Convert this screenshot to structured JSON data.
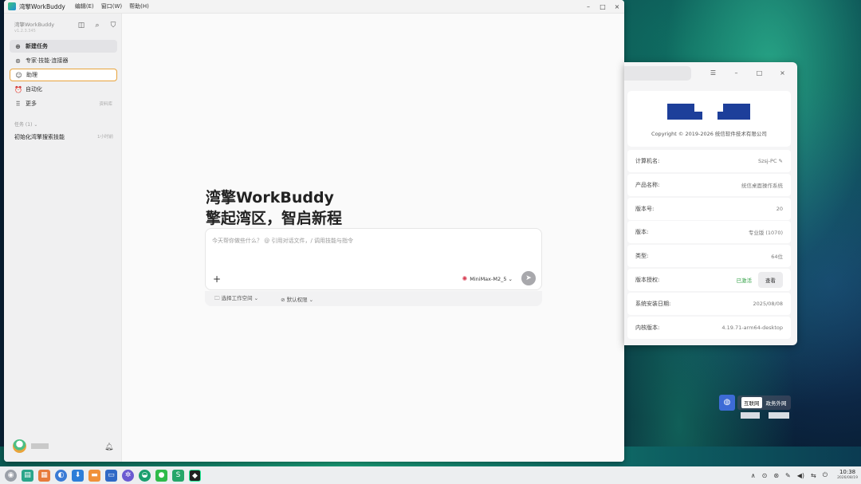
{
  "app": {
    "name": "湾擎WorkBuddy",
    "menus": [
      "编辑(E)",
      "窗口(W)",
      "帮助(H)"
    ],
    "controls": {
      "minimize": "–",
      "maximize": "□",
      "close": "×"
    }
  },
  "sidebar": {
    "brand_title": "湾擎WorkBuddy",
    "brand_version": "v1.2.3.345",
    "tools": [
      {
        "icon": "panel-toggle-icon",
        "glyph": "◫"
      },
      {
        "icon": "search-icon",
        "glyph": "⌕"
      },
      {
        "icon": "filter-icon",
        "glyph": "⛉"
      }
    ],
    "nav": [
      {
        "label": "新建任务",
        "glyph": "⊕",
        "icon": "new-task-icon",
        "extra": ""
      },
      {
        "label": "专家·技能·连接器",
        "glyph": "⊛",
        "icon": "expert-icon",
        "extra": ""
      },
      {
        "label": "助理",
        "glyph": "☺",
        "icon": "assistant-icon",
        "extra": ""
      },
      {
        "label": "自动化",
        "glyph": "⏰",
        "icon": "automation-icon",
        "extra": ""
      },
      {
        "label": "更多",
        "glyph": "⠿",
        "icon": "more-icon",
        "extra": "资料库"
      }
    ],
    "tasks_header": "任务 (1) ⌄",
    "task": {
      "title": "初始化湾擎搜索技能",
      "time": "1小时前"
    }
  },
  "main": {
    "hero_line1": "湾擎WorkBuddy",
    "hero_line2": "擎起湾区，智启新程",
    "placeholder": "今天帮你做些什么？ @ 引用对话文件，/ 调用技能与指令",
    "plus": "+",
    "model": "MiniMax-M2_5 ⌄",
    "send": "➤",
    "workspace": "选择工作空间 ⌄",
    "permission": "默认权限 ⌄"
  },
  "sysinfo": {
    "controls": [
      "☰",
      "–",
      "□",
      "×"
    ],
    "copyright": "Copyright © 2019-2026 统信软件技术有限公司",
    "rows": [
      {
        "key": "计算机名:",
        "value": "Szsj-PC ✎"
      },
      {
        "key": "产品名称:",
        "value": "统信桌面操作系统"
      },
      {
        "key": "版本号:",
        "value": "20"
      },
      {
        "key": "版本:",
        "value": "专业版 (1070)"
      },
      {
        "key": "类型:",
        "value": "64位"
      },
      {
        "key": "版本授权:",
        "value": "已激活",
        "button": "查看"
      },
      {
        "key": "系统安装日期:",
        "value": "2025/08/08"
      },
      {
        "key": "内核版本:",
        "value": "4.19.71-arm64-desktop"
      }
    ],
    "brand_color": "#1d3f9a",
    "active_color": "#37a34a"
  },
  "network": {
    "on_label": "互联网",
    "off_label": "政务外网"
  },
  "taskbar": {
    "time": "10:38",
    "date": "2026/08/19",
    "tray": [
      "∧",
      "⊙",
      "⊛",
      "✎",
      "◀)",
      "⇆",
      "⏻"
    ]
  }
}
